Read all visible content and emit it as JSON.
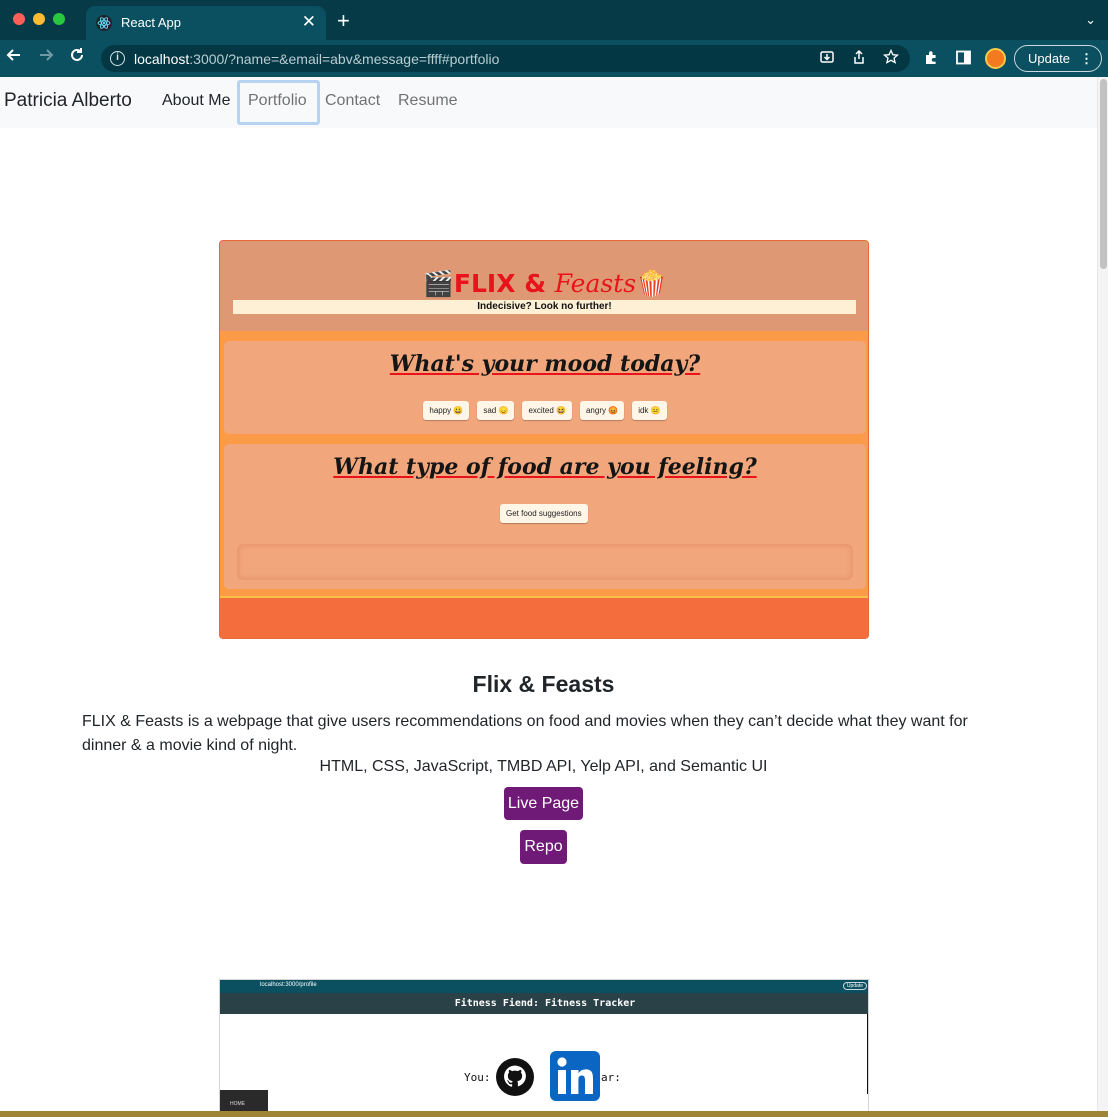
{
  "browser": {
    "tab_title": "React App",
    "tab_close": "✕",
    "new_tab": "+",
    "tab_menu": "⌄",
    "url_host": "localhost",
    "url_rest": ":3000/?name=&email=abv&message=ffff#portfolio",
    "update_label": "Update",
    "update_menu": "⋮",
    "icons": [
      "react-icon",
      "back-arrow-icon",
      "forward-arrow-icon",
      "reload-icon",
      "info-icon",
      "install-icon",
      "share-icon",
      "star-icon",
      "puzzle-icon",
      "side-panel-icon",
      "profile-icon",
      "kebab-icon"
    ],
    "accent": "#0b5060"
  },
  "navbar": {
    "brand": "Patricia Alberto",
    "links": [
      "About Me",
      "Portfolio",
      "Contact",
      "Resume"
    ],
    "active": "Portfolio"
  },
  "project1": {
    "screenshot": {
      "title_a": "FLIX & ",
      "title_b": "Feasts",
      "subtitle": "Indecisive? Look no further!",
      "mood_question": "What's your mood today?",
      "moods": [
        "happy 😀",
        "sad 😞",
        "excited 😆",
        "angry 😡",
        "idk 😐"
      ],
      "food_question": "What type of food are you feeling?",
      "food_button": "Get food suggestions"
    },
    "title": "Flix & Feasts",
    "description": "FLIX & Feasts is a webpage that give users recommendations on food and movies when they can’t decide what they want for dinner & a movie kind of night.",
    "tech": "HTML, CSS, JavaScript, TMBD API, Yelp API, and Semantic UI",
    "live_label": "Live Page",
    "repo_label": "Repo",
    "button_color": "#6f1a76"
  },
  "project2": {
    "screenshot": {
      "url": "localhost:3000/profile",
      "update": "Update",
      "title": "Fitness Fiend: Fitness Tracker",
      "label_a": "You:",
      "label_b": "ar:",
      "side_label": "HOME"
    }
  }
}
